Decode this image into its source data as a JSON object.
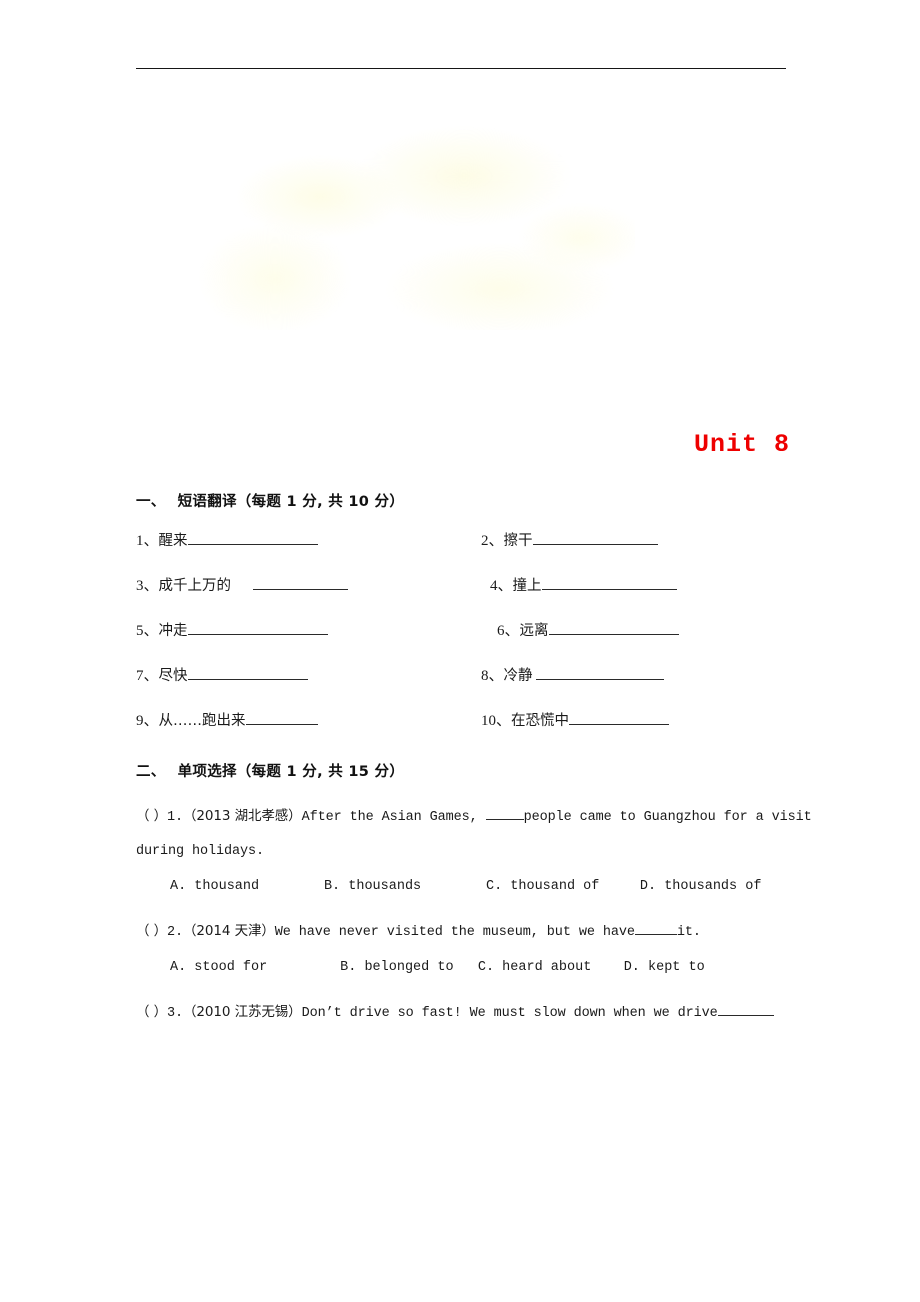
{
  "document": {
    "title": "Unit 8",
    "title_color": "#ee0000"
  },
  "sections": [
    {
      "num": "一、",
      "heading": "短语翻译（每题 1 分, 共 10 分）",
      "items": [
        {
          "index": "1、",
          "label": "醒来",
          "blank_width": 130,
          "gap": 0
        },
        {
          "index": "2、",
          "label": "擦干",
          "blank_width": 125,
          "gap": 0
        },
        {
          "index": "3、",
          "label": "成千上万的",
          "blank_width": 95,
          "gap": 22
        },
        {
          "index": "4、",
          "label": "撞上",
          "blank_width": 135,
          "gap": 0
        },
        {
          "index": "5、",
          "label": "冲走",
          "blank_width": 140,
          "gap": 0
        },
        {
          "index": "6、",
          "label": "远离",
          "blank_width": 130,
          "gap": 0
        },
        {
          "index": "7、",
          "label": "尽快",
          "blank_width": 120,
          "gap": 0
        },
        {
          "index": "8、",
          "label": "冷静",
          "blank_width": 128,
          "gap": 3
        },
        {
          "index": "9、",
          "label": "从……跑出来",
          "blank_width": 72,
          "gap": 0
        },
        {
          "index": "10、",
          "label": "在恐慌中",
          "blank_width": 100,
          "gap": 0
        }
      ]
    },
    {
      "num": "二、",
      "heading": "单项选择（每题 1 分, 共 15 分）",
      "questions": [
        {
          "bracket": "（ ）",
          "number": "1.",
          "source": "（2013 湖北孝感）",
          "stem_before": "After the Asian Games, ",
          "blank_width": 38,
          "stem_after": "people came to Guangzhou for a visit during  holidays.",
          "options": [
            "A. thousand",
            "B. thousands",
            "C. thousand of",
            "D. thousands of"
          ]
        },
        {
          "bracket": "（ ）",
          "number": "2.",
          "source": "（2014 天津）",
          "stem_before": "We have never visited the museum, but we have",
          "blank_width": 42,
          "stem_after": "it.",
          "options": [
            "A. stood for",
            "B. belonged to",
            "C. heard about",
            "D. kept to"
          ]
        },
        {
          "bracket": "（ ）",
          "number": "3.",
          "source": "（2010 江苏无锡）",
          "stem_before": "Don’t drive so fast! We must slow down when we drive",
          "blank_width": 56,
          "stem_after": "",
          "options": []
        }
      ]
    }
  ]
}
